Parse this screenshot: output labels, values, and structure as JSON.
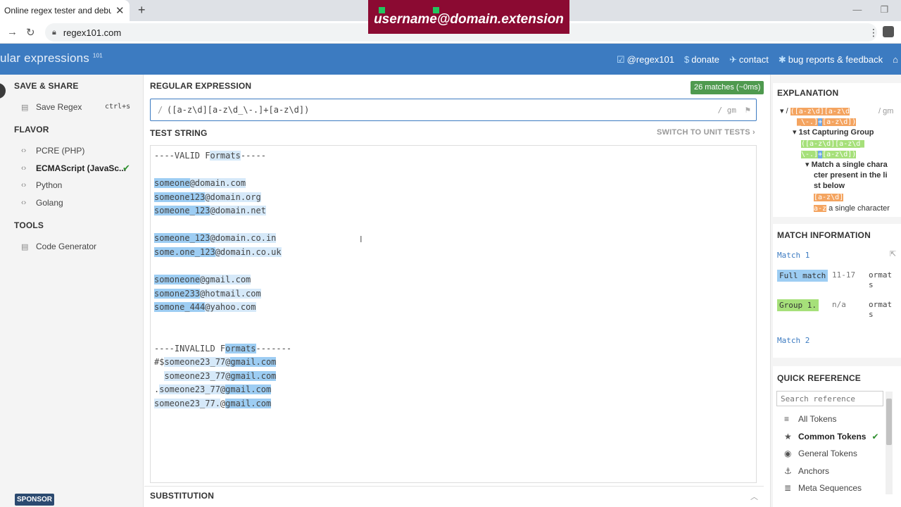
{
  "browser": {
    "tab_title": "Online regex tester and debugger",
    "tab_close": "✕",
    "new_tab": "+",
    "url": "regex101.com",
    "back": "→",
    "reload": "↻",
    "win_min": "—",
    "win_max": "❐"
  },
  "overlay": {
    "text": "username@domain.extension"
  },
  "header": {
    "logo": "ular expressions",
    "logo_sup": "101",
    "links": [
      {
        "icon": "twitter-icon",
        "glyph": "☑",
        "label": "@regex101"
      },
      {
        "icon": "dollar-icon",
        "glyph": "$",
        "label": "donate"
      },
      {
        "icon": "send-icon",
        "glyph": "✈",
        "label": "contact"
      },
      {
        "icon": "bug-icon",
        "glyph": "✱",
        "label": "bug reports & feedback"
      }
    ],
    "bank_glyph": "⌂"
  },
  "sidebar": {
    "save_share": "SAVE & SHARE",
    "save_regex": "Save Regex",
    "save_shortcut": "ctrl+s",
    "flavor": "FLAVOR",
    "flavors": [
      "PCRE (PHP)",
      "ECMAScript (JavaSc...",
      "Python",
      "Golang"
    ],
    "selected_flavor_index": 1,
    "tools": "TOOLS",
    "code_generator": "Code Generator",
    "sponsor": "SPONSOR"
  },
  "main": {
    "regex_heading": "REGULAR EXPRESSION",
    "match_badge": "26 matches (~0ms)",
    "delimiter": "/",
    "regex": "([a-z\\d][a-z\\d_\\-.]+[a-z\\d])",
    "flags": "/ gm",
    "test_heading": "TEST STRING",
    "switch_unit": "SWITCH TO UNIT TESTS ›",
    "substitution": "SUBSTITUTION",
    "lines": [
      [
        [
          "t",
          "----VALID F"
        ],
        [
          "l",
          "ormats"
        ],
        [
          "t",
          "-----"
        ]
      ],
      [],
      [
        [
          "m",
          "someone"
        ],
        [
          "l",
          "@domain.com"
        ]
      ],
      [
        [
          "m",
          "someone123"
        ],
        [
          "l",
          "@domain.org"
        ]
      ],
      [
        [
          "m",
          "someone_123"
        ],
        [
          "l",
          "@domain.net"
        ]
      ],
      [],
      [
        [
          "m",
          "someone_123"
        ],
        [
          "l",
          "@domain.co.in"
        ]
      ],
      [
        [
          "m",
          "some.one_123"
        ],
        [
          "l",
          "@domain.co.uk"
        ]
      ],
      [],
      [
        [
          "m",
          "somoneone"
        ],
        [
          "l",
          "@gmail.com"
        ]
      ],
      [
        [
          "m",
          "somone233"
        ],
        [
          "l",
          "@hotmail.com"
        ]
      ],
      [
        [
          "m",
          "somone_444"
        ],
        [
          "l",
          "@yahoo.com"
        ]
      ],
      [],
      [],
      [
        [
          "t",
          "----INVALILD F"
        ],
        [
          "m",
          "ormats"
        ],
        [
          "t",
          "-------"
        ]
      ],
      [
        [
          "t",
          "#$"
        ],
        [
          "l",
          "someone23_77@"
        ],
        [
          "m",
          "gmail.com"
        ]
      ],
      [
        [
          "t",
          "  "
        ],
        [
          "l",
          "someone23_77@"
        ],
        [
          "m",
          "gmail.com"
        ]
      ],
      [
        [
          "t",
          "."
        ],
        [
          "l",
          "someone23_77@"
        ],
        [
          "m",
          "gmail.com"
        ]
      ],
      [
        [
          "l",
          "someone23_77."
        ],
        [
          "t",
          "@"
        ],
        [
          "m",
          "gmail.com"
        ]
      ]
    ]
  },
  "explanation": {
    "heading": "EXPLANATION",
    "row1_pre": "▾ /",
    "row1_tok_a": "([a-z\\d][a-z\\d",
    "row1_flags": "/ gm",
    "row2_tok_a": "_\\-.]",
    "row2_tok_b": "+",
    "row2_tok_c": "[a-z\\d])",
    "group_label": "▾ 1st Capturing Group",
    "group_tok_1": "([a-z\\d][a-z\\d_",
    "group_tok_2": "\\-.]",
    "group_tok_3": "+",
    "group_tok_4": "[a-z\\d])",
    "match_single_1": "▾ Match a single chara",
    "match_single_2": "cter present in the li",
    "match_single_3": "st below",
    "class_tok": "[a-z\\d]",
    "range_tok": "a-z",
    "range_text": "a single character"
  },
  "match_info": {
    "heading": "MATCH INFORMATION",
    "match1": "Match 1",
    "full_match": "Full match",
    "full_range": "11-17",
    "full_value_1": "ormat",
    "full_value_2": "s",
    "group1": "Group 1.",
    "group_range": "n/a",
    "group_value_1": "ormat",
    "group_value_2": "s",
    "match2": "Match 2"
  },
  "quick_ref": {
    "heading": "QUICK REFERENCE",
    "placeholder": "Search reference",
    "items": [
      {
        "icon": "database-icon",
        "glyph": "≡",
        "label": "All Tokens"
      },
      {
        "icon": "star-icon",
        "glyph": "★",
        "label": "Common Tokens"
      },
      {
        "icon": "circle-dot-icon",
        "glyph": "◉",
        "label": "General Tokens"
      },
      {
        "icon": "anchor-icon",
        "glyph": "⚓",
        "label": "Anchors"
      },
      {
        "icon": "stack-icon",
        "glyph": "≣",
        "label": "Meta Sequences"
      }
    ],
    "selected_index": 1
  },
  "colors": {
    "accent": "#3c7bc1",
    "match": "#9dcdf3",
    "group": "#a6e07a",
    "token": "#f4a460",
    "overlay": "#8b0a32"
  }
}
